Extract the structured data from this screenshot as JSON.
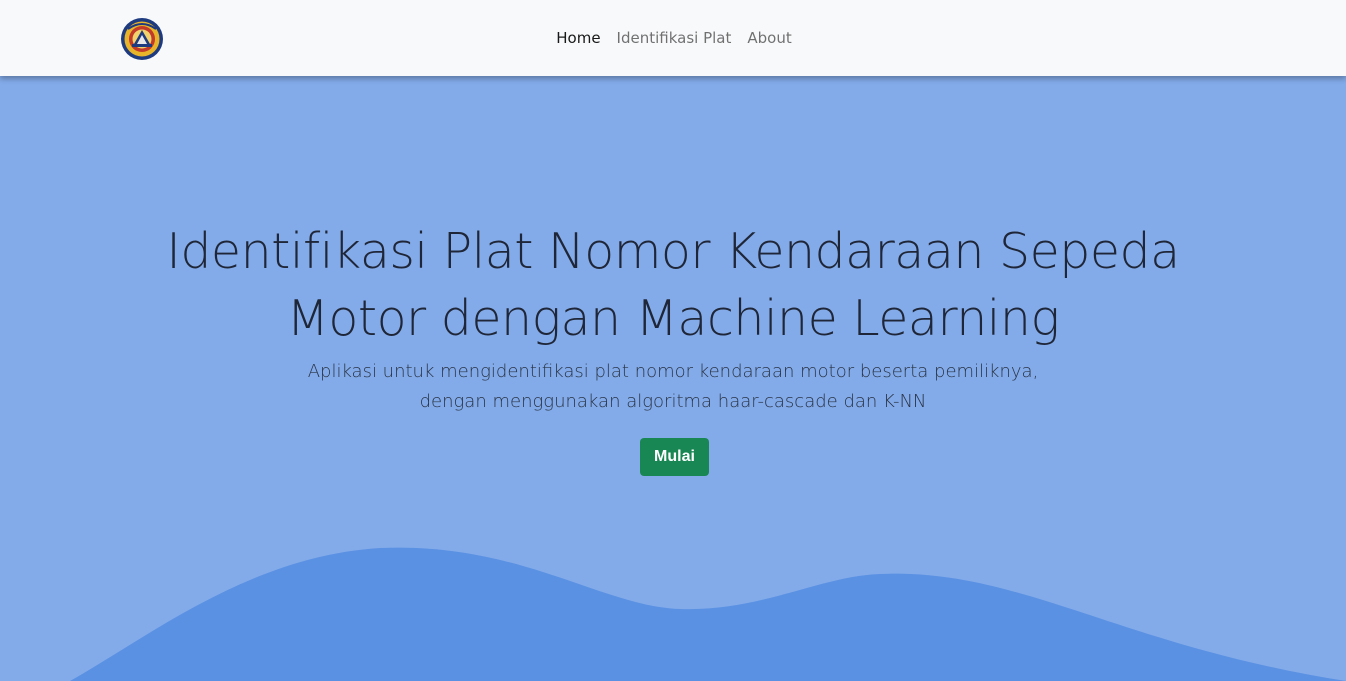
{
  "colors": {
    "navbar_bg": "#f8f9fa",
    "hero_bg": "#83abe9",
    "wave": "#5b91e3",
    "button": "#198754",
    "text_dark": "#1f2637"
  },
  "navbar": {
    "logo": "university-emblem-logo",
    "links": [
      {
        "label": "Home",
        "active": true
      },
      {
        "label": "Identifikasi Plat",
        "active": false
      },
      {
        "label": "About",
        "active": false
      }
    ]
  },
  "hero": {
    "title_line1": "Identifikasi Plat Nomor Kendaraan Sepeda",
    "title_line2": "Motor dengan Machine Learning",
    "subtitle_line1": "Aplikasi untuk mengidentifikasi plat nomor kendaraan motor beserta pemiliknya,",
    "subtitle_line2": "dengan menggunakan algoritma haar-cascade dan K-NN",
    "button_label": "Mulai"
  }
}
